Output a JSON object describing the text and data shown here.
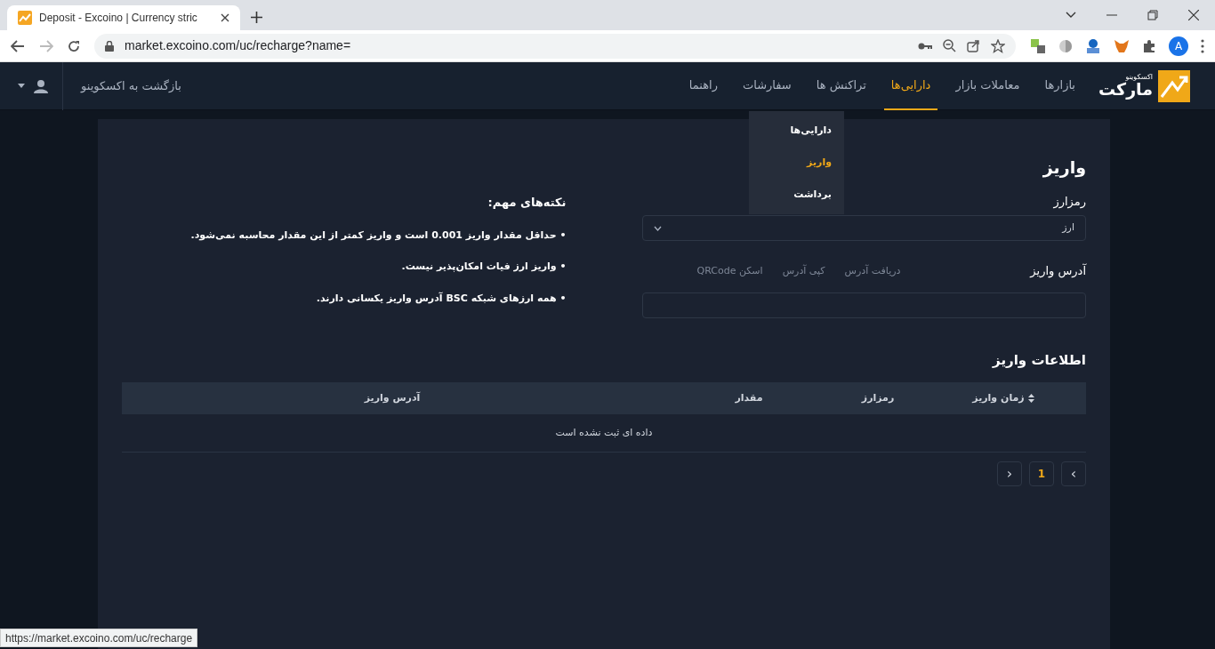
{
  "browser": {
    "tab_title": "Deposit - Excoino | Currency stric",
    "url": "market.excoino.com/uc/recharge?name=",
    "profile_initial": "A"
  },
  "header": {
    "logo": {
      "small": "اکسکوینو",
      "big": "مارکت"
    },
    "nav": [
      {
        "label": "بازارها",
        "selected": false
      },
      {
        "label": "معاملات بازار",
        "selected": false
      },
      {
        "label": "دارایی‌ها",
        "selected": true
      },
      {
        "label": "تراکنش ها",
        "selected": false
      },
      {
        "label": "سفارشات",
        "selected": false
      },
      {
        "label": "راهنما",
        "selected": false
      }
    ],
    "back_link": "بازگشت به اکسکوینو"
  },
  "dropdown": {
    "items": [
      {
        "label": "دارایی‌ها",
        "selected": false
      },
      {
        "label": "واریز",
        "selected": true
      },
      {
        "label": "برداشت",
        "selected": false
      }
    ]
  },
  "deposit": {
    "title": "واریز",
    "currency_label": "رمزارز",
    "currency_select": {
      "value": "ارز"
    },
    "address_label": "آدرس واریز",
    "address_actions": [
      "دریافت آدرس",
      "کپی آدرس",
      "اسکن QRCode"
    ]
  },
  "notes": {
    "title": "نکته‌های مهم:",
    "items": [
      "• حداقل مقدار واریز 0.001 است و واریز کمتر از این مقدار محاسبه نمی‌شود.",
      "• واریز ارز فیات امکان‌پذیر نیست.",
      "• همه ارزهای شبکه BSC آدرس واریز یکسانی دارند."
    ]
  },
  "table": {
    "title": "اطلاعات واریز",
    "columns": [
      {
        "label": "زمان واریز",
        "sortable": true
      },
      {
        "label": "رمزارز",
        "sortable": false
      },
      {
        "label": "مقدار",
        "sortable": false
      },
      {
        "label": "آدرس واریز",
        "sortable": false
      }
    ],
    "empty_text": "داده ای ثبت نشده است"
  },
  "pagination": {
    "prev": "›",
    "next": "‹",
    "pages": [
      {
        "label": "1",
        "selected": true
      }
    ]
  },
  "status_url": "https://market.excoino.com/uc/recharge"
}
